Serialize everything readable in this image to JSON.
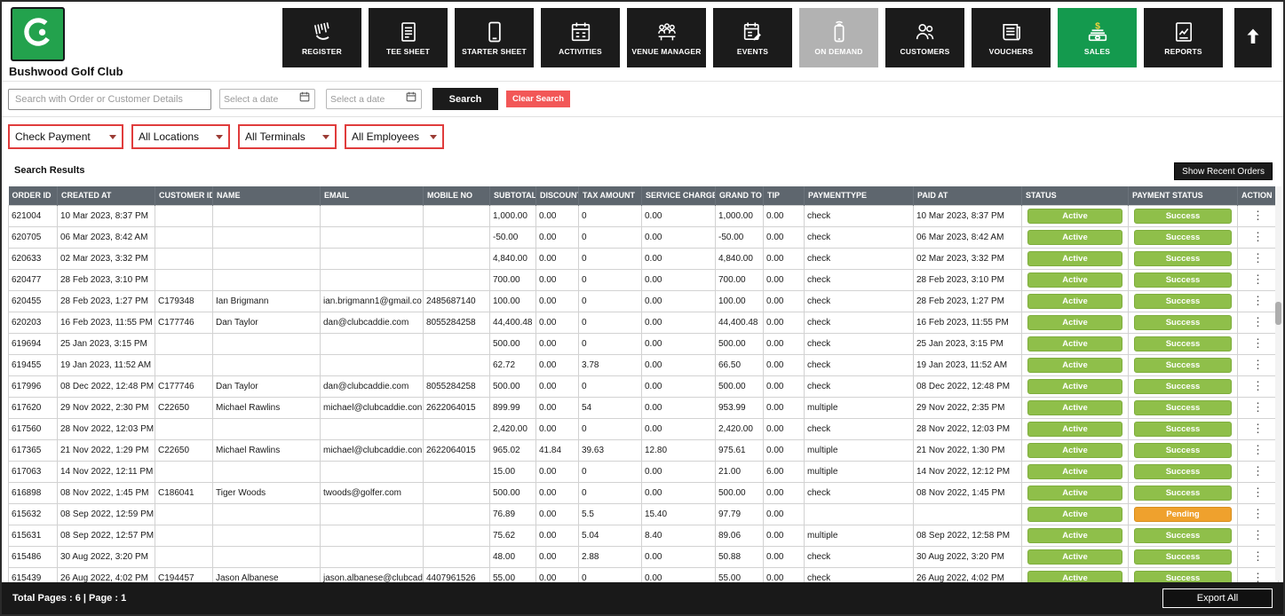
{
  "colors": {
    "brand_green": "#23a24d",
    "active_nav_green": "#149a4e",
    "nav_black": "#1b1b1b",
    "disabled_gray": "#b2b2b2",
    "danger_red": "#f25757",
    "filter_highlight_red": "#e03c3c",
    "table_header_gray": "#5e666e",
    "badge_green": "#8fbf4a",
    "badge_orange": "#efa12d"
  },
  "header": {
    "club_name": "Bushwood Golf Club"
  },
  "nav": {
    "items": [
      {
        "label": "REGISTER",
        "icon": "barcode-scanner-icon",
        "state": "default"
      },
      {
        "label": "TEE SHEET",
        "icon": "tee-sheet-icon",
        "state": "default"
      },
      {
        "label": "STARTER SHEET",
        "icon": "starter-sheet-icon",
        "state": "default"
      },
      {
        "label": "ACTIVITIES",
        "icon": "activities-calendar-icon",
        "state": "default"
      },
      {
        "label": "VENUE MANAGER",
        "icon": "venue-manager-icon",
        "state": "default"
      },
      {
        "label": "EVENTS",
        "icon": "events-calendar-icon",
        "state": "default"
      },
      {
        "label": "ON DEMAND",
        "icon": "on-demand-phone-icon",
        "state": "disabled"
      },
      {
        "label": "CUSTOMERS",
        "icon": "customers-icon",
        "state": "default"
      },
      {
        "label": "VOUCHERS",
        "icon": "vouchers-icon",
        "state": "default"
      },
      {
        "label": "SALES",
        "icon": "sales-cash-icon",
        "state": "active"
      },
      {
        "label": "REPORTS",
        "icon": "reports-icon",
        "state": "default"
      }
    ]
  },
  "search": {
    "placeholder": "Search with Order or Customer Details",
    "date_from_placeholder": "Select a date",
    "date_to_placeholder": "Select a date",
    "search_button": "Search",
    "clear_button": "Clear Search"
  },
  "filters": {
    "payment_type": "Check Payment",
    "location": "All Locations",
    "terminal": "All Terminals",
    "employee": "All Employees"
  },
  "results": {
    "title": "Search Results",
    "show_recent_button": "Show Recent Orders"
  },
  "table": {
    "columns": [
      "ORDER ID",
      "CREATED AT",
      "CUSTOMER ID",
      "NAME",
      "EMAIL",
      "MOBILE NO",
      "SUBTOTAL",
      "DISCOUNT",
      "TAX AMOUNT",
      "SERVICE CHARGE",
      "GRAND TO",
      "TIP",
      "PAYMENTTYPE",
      "PAID AT",
      "STATUS",
      "PAYMENT STATUS",
      "ACTION"
    ],
    "rows": [
      {
        "order_id": "621004",
        "created_at": "10 Mar 2023, 8:37 PM",
        "customer_id": "",
        "name": "",
        "email": "",
        "mobile_no": "",
        "subtotal": "1,000.00",
        "discount": "0.00",
        "tax_amount": "0",
        "service_charge": "0.00",
        "grand_total": "1,000.00",
        "tip": "0.00",
        "payment_type": "check",
        "paid_at": "10 Mar 2023, 8:37 PM",
        "status": "Active",
        "payment_status": "Success"
      },
      {
        "order_id": "620705",
        "created_at": "06 Mar 2023, 8:42 AM",
        "customer_id": "",
        "name": "",
        "email": "",
        "mobile_no": "",
        "subtotal": "-50.00",
        "discount": "0.00",
        "tax_amount": "0",
        "service_charge": "0.00",
        "grand_total": "-50.00",
        "tip": "0.00",
        "payment_type": "check",
        "paid_at": "06 Mar 2023, 8:42 AM",
        "status": "Active",
        "payment_status": "Success"
      },
      {
        "order_id": "620633",
        "created_at": "02 Mar 2023, 3:32 PM",
        "customer_id": "",
        "name": "",
        "email": "",
        "mobile_no": "",
        "subtotal": "4,840.00",
        "discount": "0.00",
        "tax_amount": "0",
        "service_charge": "0.00",
        "grand_total": "4,840.00",
        "tip": "0.00",
        "payment_type": "check",
        "paid_at": "02 Mar 2023, 3:32 PM",
        "status": "Active",
        "payment_status": "Success"
      },
      {
        "order_id": "620477",
        "created_at": "28 Feb 2023, 3:10 PM",
        "customer_id": "",
        "name": "",
        "email": "",
        "mobile_no": "",
        "subtotal": "700.00",
        "discount": "0.00",
        "tax_amount": "0",
        "service_charge": "0.00",
        "grand_total": "700.00",
        "tip": "0.00",
        "payment_type": "check",
        "paid_at": "28 Feb 2023, 3:10 PM",
        "status": "Active",
        "payment_status": "Success"
      },
      {
        "order_id": "620455",
        "created_at": "28 Feb 2023, 1:27 PM",
        "customer_id": "C179348",
        "name": "Ian Brigmann",
        "email": "ian.brigmann1@gmail.co",
        "mobile_no": "2485687140",
        "subtotal": "100.00",
        "discount": "0.00",
        "tax_amount": "0",
        "service_charge": "0.00",
        "grand_total": "100.00",
        "tip": "0.00",
        "payment_type": "check",
        "paid_at": "28 Feb 2023, 1:27 PM",
        "status": "Active",
        "payment_status": "Success"
      },
      {
        "order_id": "620203",
        "created_at": "16 Feb 2023, 11:55 PM",
        "customer_id": "C177746",
        "name": "Dan Taylor",
        "email": "dan@clubcaddie.com",
        "mobile_no": "8055284258",
        "subtotal": "44,400.48",
        "discount": "0.00",
        "tax_amount": "0",
        "service_charge": "0.00",
        "grand_total": "44,400.48",
        "tip": "0.00",
        "payment_type": "check",
        "paid_at": "16 Feb 2023, 11:55 PM",
        "status": "Active",
        "payment_status": "Success"
      },
      {
        "order_id": "619694",
        "created_at": "25 Jan 2023, 3:15 PM",
        "customer_id": "",
        "name": "",
        "email": "",
        "mobile_no": "",
        "subtotal": "500.00",
        "discount": "0.00",
        "tax_amount": "0",
        "service_charge": "0.00",
        "grand_total": "500.00",
        "tip": "0.00",
        "payment_type": "check",
        "paid_at": "25 Jan 2023, 3:15 PM",
        "status": "Active",
        "payment_status": "Success"
      },
      {
        "order_id": "619455",
        "created_at": "19 Jan 2023, 11:52 AM",
        "customer_id": "",
        "name": "",
        "email": "",
        "mobile_no": "",
        "subtotal": "62.72",
        "discount": "0.00",
        "tax_amount": "3.78",
        "service_charge": "0.00",
        "grand_total": "66.50",
        "tip": "0.00",
        "payment_type": "check",
        "paid_at": "19 Jan 2023, 11:52 AM",
        "status": "Active",
        "payment_status": "Success"
      },
      {
        "order_id": "617996",
        "created_at": "08 Dec 2022, 12:48 PM",
        "customer_id": "C177746",
        "name": "Dan Taylor",
        "email": "dan@clubcaddie.com",
        "mobile_no": "8055284258",
        "subtotal": "500.00",
        "discount": "0.00",
        "tax_amount": "0",
        "service_charge": "0.00",
        "grand_total": "500.00",
        "tip": "0.00",
        "payment_type": "check",
        "paid_at": "08 Dec 2022, 12:48 PM",
        "status": "Active",
        "payment_status": "Success"
      },
      {
        "order_id": "617620",
        "created_at": "29 Nov 2022, 2:30 PM",
        "customer_id": "C22650",
        "name": "Michael Rawlins",
        "email": "michael@clubcaddie.con",
        "mobile_no": "2622064015",
        "subtotal": "899.99",
        "discount": "0.00",
        "tax_amount": "54",
        "service_charge": "0.00",
        "grand_total": "953.99",
        "tip": "0.00",
        "payment_type": "multiple",
        "paid_at": "29 Nov 2022, 2:35 PM",
        "status": "Active",
        "payment_status": "Success"
      },
      {
        "order_id": "617560",
        "created_at": "28 Nov 2022, 12:03 PM",
        "customer_id": "",
        "name": "",
        "email": "",
        "mobile_no": "",
        "subtotal": "2,420.00",
        "discount": "0.00",
        "tax_amount": "0",
        "service_charge": "0.00",
        "grand_total": "2,420.00",
        "tip": "0.00",
        "payment_type": "check",
        "paid_at": "28 Nov 2022, 12:03 PM",
        "status": "Active",
        "payment_status": "Success"
      },
      {
        "order_id": "617365",
        "created_at": "21 Nov 2022, 1:29 PM",
        "customer_id": "C22650",
        "name": "Michael Rawlins",
        "email": "michael@clubcaddie.con",
        "mobile_no": "2622064015",
        "subtotal": "965.02",
        "discount": "41.84",
        "tax_amount": "39.63",
        "service_charge": "12.80",
        "grand_total": "975.61",
        "tip": "0.00",
        "payment_type": "multiple",
        "paid_at": "21 Nov 2022, 1:30 PM",
        "status": "Active",
        "payment_status": "Success"
      },
      {
        "order_id": "617063",
        "created_at": "14 Nov 2022, 12:11 PM",
        "customer_id": "",
        "name": "",
        "email": "",
        "mobile_no": "",
        "subtotal": "15.00",
        "discount": "0.00",
        "tax_amount": "0",
        "service_charge": "0.00",
        "grand_total": "21.00",
        "tip": "6.00",
        "payment_type": "multiple",
        "paid_at": "14 Nov 2022, 12:12 PM",
        "status": "Active",
        "payment_status": "Success"
      },
      {
        "order_id": "616898",
        "created_at": "08 Nov 2022, 1:45 PM",
        "customer_id": "C186041",
        "name": "Tiger Woods",
        "email": "twoods@golfer.com",
        "mobile_no": "",
        "subtotal": "500.00",
        "discount": "0.00",
        "tax_amount": "0",
        "service_charge": "0.00",
        "grand_total": "500.00",
        "tip": "0.00",
        "payment_type": "check",
        "paid_at": "08 Nov 2022, 1:45 PM",
        "status": "Active",
        "payment_status": "Success"
      },
      {
        "order_id": "615632",
        "created_at": "08 Sep 2022, 12:59 PM",
        "customer_id": "",
        "name": "",
        "email": "",
        "mobile_no": "",
        "subtotal": "76.89",
        "discount": "0.00",
        "tax_amount": "5.5",
        "service_charge": "15.40",
        "grand_total": "97.79",
        "tip": "0.00",
        "payment_type": "",
        "paid_at": "",
        "status": "Active",
        "payment_status": "Pending"
      },
      {
        "order_id": "615631",
        "created_at": "08 Sep 2022, 12:57 PM",
        "customer_id": "",
        "name": "",
        "email": "",
        "mobile_no": "",
        "subtotal": "75.62",
        "discount": "0.00",
        "tax_amount": "5.04",
        "service_charge": "8.40",
        "grand_total": "89.06",
        "tip": "0.00",
        "payment_type": "multiple",
        "paid_at": "08 Sep 2022, 12:58 PM",
        "status": "Active",
        "payment_status": "Success"
      },
      {
        "order_id": "615486",
        "created_at": "30 Aug 2022, 3:20 PM",
        "customer_id": "",
        "name": "",
        "email": "",
        "mobile_no": "",
        "subtotal": "48.00",
        "discount": "0.00",
        "tax_amount": "2.88",
        "service_charge": "0.00",
        "grand_total": "50.88",
        "tip": "0.00",
        "payment_type": "check",
        "paid_at": "30 Aug 2022, 3:20 PM",
        "status": "Active",
        "payment_status": "Success"
      },
      {
        "order_id": "615439",
        "created_at": "26 Aug 2022, 4:02 PM",
        "customer_id": "C194457",
        "name": "Jason Albanese",
        "email": "jason.albanese@clubcad",
        "mobile_no": "4407961526",
        "subtotal": "55.00",
        "discount": "0.00",
        "tax_amount": "0",
        "service_charge": "0.00",
        "grand_total": "55.00",
        "tip": "0.00",
        "payment_type": "check",
        "paid_at": "26 Aug 2022, 4:02 PM",
        "status": "Active",
        "payment_status": "Success"
      }
    ]
  },
  "footer": {
    "pagination": "Total Pages : 6 | Page : 1",
    "export_button": "Export All"
  }
}
